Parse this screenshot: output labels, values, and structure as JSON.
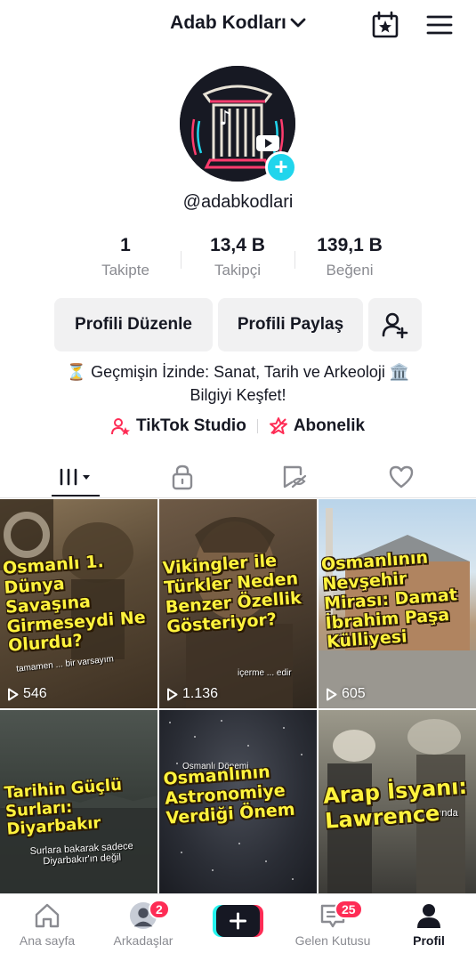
{
  "header": {
    "title": "Adab Kodları"
  },
  "profile": {
    "username": "@adabkodlari"
  },
  "stats": [
    {
      "value": "1",
      "label": "Takipte"
    },
    {
      "value": "13,4 B",
      "label": "Takipçi"
    },
    {
      "value": "139,1 B",
      "label": "Beğeni"
    }
  ],
  "buttons": {
    "edit": "Profili Düzenle",
    "share": "Profili Paylaş"
  },
  "bio": {
    "line1": "⏳ Geçmişin İzinde: Sanat, Tarih ve Arkeoloji 🏛️",
    "line2": "Bilgiyi Keşfet!"
  },
  "links": {
    "studio": "TikTok Studio",
    "subscription": "Abonelik"
  },
  "videos": [
    {
      "title": "Osmanlı 1. Dünya Savaşına Girmeseydi Ne Olurdu?",
      "views": "546",
      "sub": "tamamen ... bir varsayım"
    },
    {
      "title": "Vikingler ile Türkler Neden Benzer Özellik Gösteriyor?",
      "views": "1.136",
      "sub": "içerme ... edir"
    },
    {
      "title": "Osmanlının Nevşehir Mirası: Damat İbrahim Paşa Külliyesi",
      "views": "605",
      "sub": ""
    },
    {
      "title": "Tarihin Güçlü Surları: Diyarbakır",
      "views": "",
      "sub": "Surlara bakarak sadece Diyarbakır'ın değil"
    },
    {
      "title": "Osmanlının Astronomiye Verdiği Önem",
      "views": "",
      "sub": "Osmanlı Dönemi"
    },
    {
      "title": "Arap İsyanı: Lawrence",
      "views": "",
      "sub": "rasında"
    }
  ],
  "nav": {
    "home": "Ana sayfa",
    "friends": "Arkadaşlar",
    "friends_badge": "2",
    "inbox": "Gelen Kutusu",
    "inbox_badge": "25",
    "profile": "Profil"
  },
  "colors": {
    "accent_pink": "#fe2c55",
    "accent_cyan": "#20d5ec",
    "caption_yellow": "#fff33d"
  }
}
